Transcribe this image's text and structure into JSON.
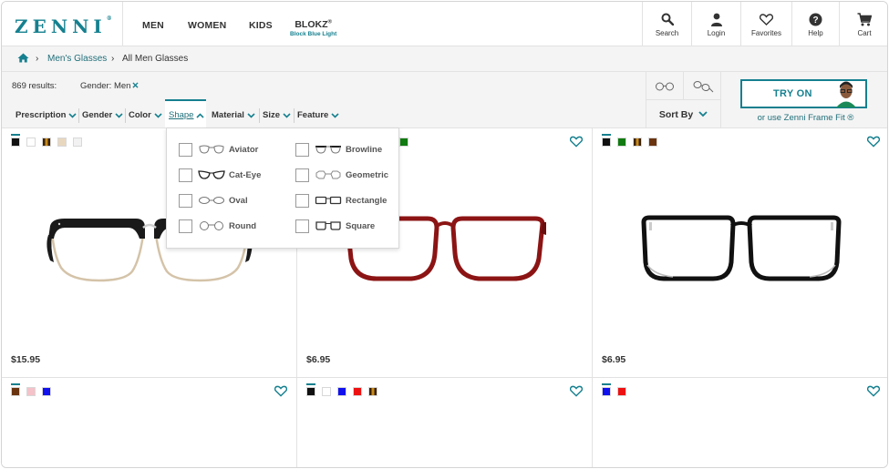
{
  "brand": {
    "logo_text": "ZENNI",
    "tm": "®"
  },
  "nav": {
    "items": [
      {
        "label": "MEN"
      },
      {
        "label": "WOMEN"
      },
      {
        "label": "KIDS"
      }
    ],
    "blokz": {
      "label": "BLOKZ",
      "mark": "®",
      "sub": "Block Blue Light"
    }
  },
  "utility": [
    {
      "label": "Search",
      "icon": "search-icon"
    },
    {
      "label": "Login",
      "icon": "user-icon"
    },
    {
      "label": "Favorites",
      "icon": "heart-icon"
    },
    {
      "label": "Help",
      "icon": "help-icon"
    },
    {
      "label": "Cart",
      "icon": "cart-icon"
    }
  ],
  "breadcrumb": {
    "home_icon": "home-icon",
    "link": "Men's Glasses",
    "current": "All Men Glasses"
  },
  "filters": {
    "results": "869 results:",
    "chip": {
      "label": "Gender: Men",
      "remove": "✕"
    },
    "options": [
      {
        "label": "Prescription"
      },
      {
        "label": "Gender"
      },
      {
        "label": "Color"
      },
      {
        "label": "Shape",
        "active": true
      },
      {
        "label": "Material"
      },
      {
        "label": "Size"
      },
      {
        "label": "Feature"
      }
    ],
    "sort_label": "Sort By",
    "try_on_label": "TRY ON",
    "frame_fit_link": "or use Zenni Frame Fit ®"
  },
  "shape_dropdown": {
    "options": [
      {
        "label": "Aviator"
      },
      {
        "label": "Browline"
      },
      {
        "label": "Cat-Eye"
      },
      {
        "label": "Geometric"
      },
      {
        "label": "Oval"
      },
      {
        "label": "Rectangle"
      },
      {
        "label": "Round"
      },
      {
        "label": "Square"
      }
    ]
  },
  "products": [
    {
      "price": "$15.95",
      "swatches": [
        "#111111",
        "#ffffff",
        "#8a5a12",
        "#e8d7bf",
        "#f2f2f2"
      ]
    },
    {
      "price": "$6.95",
      "swatches": [
        "#1f6d2a",
        "#7a1e1e",
        "#117a11"
      ]
    },
    {
      "price": "$6.95",
      "swatches": [
        "#111111",
        "#117a11",
        "#8a5a12",
        "#6a3410"
      ]
    },
    {
      "price": "",
      "swatches": [
        "#6a3410",
        "#f4c2c8",
        "#1111ee"
      ]
    },
    {
      "price": "",
      "swatches": [
        "#111111",
        "#ffffff",
        "#1111ee",
        "#ee1111",
        "#8a5a12"
      ]
    },
    {
      "price": "",
      "swatches": [
        "#1111ee",
        "#ee1111"
      ]
    }
  ],
  "colors": {
    "accent": "#15808f",
    "link": "#1f6f7a",
    "bar_bg": "#f4f4f4"
  }
}
